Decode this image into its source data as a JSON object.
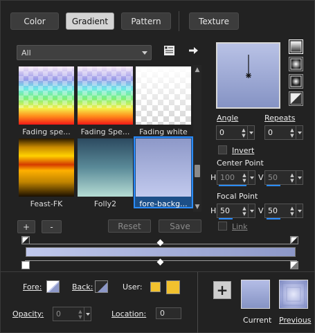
{
  "tabs": [
    "Color",
    "Gradient",
    "Pattern",
    "Texture"
  ],
  "active_tab": "Gradient",
  "category_select": {
    "value": "All"
  },
  "gradients": [
    {
      "label": "Fading spe..."
    },
    {
      "label": "Fading Spe..."
    },
    {
      "label": "Fading white"
    },
    {
      "label": "Feast-FK"
    },
    {
      "label": "Folly2"
    },
    {
      "label": "fore-backg...",
      "selected": true
    }
  ],
  "list_buttons": {
    "add": "+",
    "remove": "-",
    "reset": "Reset",
    "save": "Save"
  },
  "angle": {
    "label": "Angle",
    "value": "0"
  },
  "repeats": {
    "label": "Repeats",
    "value": "0"
  },
  "invert": {
    "label": "Invert",
    "checked": false
  },
  "center_point": {
    "label": "Center Point",
    "h_label": "H",
    "h": "100",
    "v_label": "V",
    "v": "50"
  },
  "focal_point": {
    "label": "Focal Point",
    "h_label": "H",
    "h": "50",
    "v_label": "V",
    "v": "50"
  },
  "link": {
    "label": "Link",
    "checked": false
  },
  "gradient_colors": {
    "start": "#c0c8ec",
    "end": "#8d98c8"
  },
  "bottom": {
    "fore_label": "Fore:",
    "back_label": "Back:",
    "user_label": "User:",
    "user_color": "#f2c12e",
    "opacity_label": "Opacity:",
    "opacity": "0",
    "location_label": "Location:",
    "location": "0"
  },
  "current_label": "Current",
  "previous_label": "Previous",
  "icons": [
    "list-view-icon",
    "arrow-right-icon",
    "linear-style-icon",
    "radial-style-icon",
    "rectangular-style-icon",
    "sunburst-style-icon",
    "plus-icon"
  ]
}
